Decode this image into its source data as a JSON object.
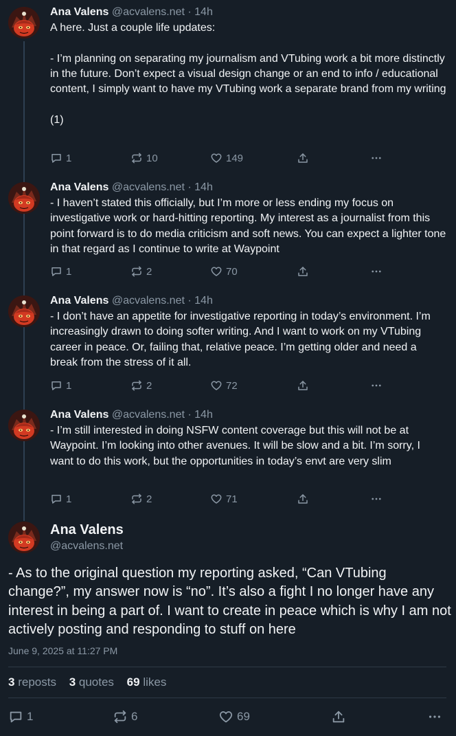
{
  "thread": [
    {
      "author": "Ana Valens",
      "handle": "@acvalens.net",
      "separator": "·",
      "time": "14h",
      "text": "A here. Just a couple life updates:\n\n- I’m planning on separating my journalism and VTubing work a bit more distinctly in the future. Don’t expect a visual design change or an end to info / educational content, I simply want to have my VTubing work a separate brand from my writing\n\n(1)",
      "replies": "1",
      "reposts": "10",
      "likes": "149"
    },
    {
      "author": "Ana Valens",
      "handle": "@acvalens.net",
      "separator": "·",
      "time": "14h",
      "text": "- I haven’t stated this officially, but I’m more or less ending my focus on investigative work or hard-hitting reporting. My interest as a journalist from this point forward is to do media criticism and soft news. You can expect a lighter tone in that regard as I continue to write at Waypoint",
      "replies": "1",
      "reposts": "2",
      "likes": "70"
    },
    {
      "author": "Ana Valens",
      "handle": "@acvalens.net",
      "separator": "·",
      "time": "14h",
      "text": "- I don’t have an appetite for investigative reporting in today’s environment. I’m increasingly drawn to doing softer writing. And I want to work on my VTubing career in peace. Or, failing that, relative peace. I’m getting older and need a break from the stress of it all.",
      "replies": "1",
      "reposts": "2",
      "likes": "72"
    },
    {
      "author": "Ana Valens",
      "handle": "@acvalens.net",
      "separator": "·",
      "time": "14h",
      "text": "- I’m still interested in doing NSFW content coverage but this will not be at Waypoint. I’m looking into other avenues. It will be slow and a bit. I’m sorry, I want to do this work, but the opportunities in today’s envt are very slim",
      "replies": "1",
      "reposts": "2",
      "likes": "71"
    }
  ],
  "main_post": {
    "author": "Ana Valens",
    "handle": "@acvalens.net",
    "text": "- As to the original question my reporting asked, “Can VTubing change?”, my answer now is “no”. It’s also a fight I no longer have any interest in being a part of. I want to create in peace which is why I am not actively posting and responding to stuff on here",
    "date": "June 9, 2025 at 11:27 PM",
    "stats": {
      "reposts_count": "3",
      "reposts_label": "reposts",
      "quotes_count": "3",
      "quotes_label": "quotes",
      "likes_count": "69",
      "likes_label": "likes"
    },
    "replies": "1",
    "reposts": "6",
    "likes": "69"
  },
  "icons": {
    "reply": "speech-bubble-icon",
    "repost": "repost-arrows-icon",
    "like": "heart-outline-icon",
    "share": "share-upload-icon",
    "more": "ellipsis-icon"
  },
  "colors": {
    "background": "#161e27",
    "text": "#f1f3f5",
    "muted": "#8b98a5",
    "thread_line": "#2e4052",
    "divider": "#2e3a46"
  }
}
